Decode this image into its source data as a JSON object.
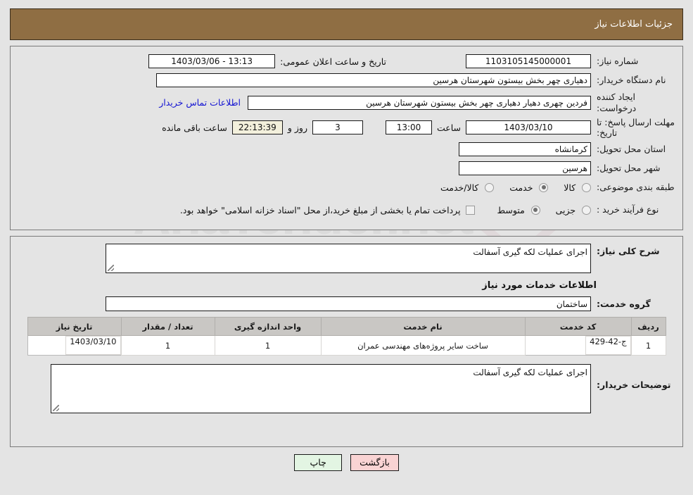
{
  "header": {
    "title": "جزئیات اطلاعات نیاز"
  },
  "info": {
    "need_number_label": "شماره نیاز:",
    "need_number_value": "1103105145000001",
    "announce_label": "تاریخ و ساعت اعلان عمومی:",
    "announce_value": "1403/03/06 - 13:13",
    "buyer_org_label": "نام دستگاه خریدار:",
    "buyer_org_value": "دهیاری چهر بخش بیستون شهرستان هرسین",
    "creator_label": "ایجاد کننده درخواست:",
    "creator_value": "فردین چهری دهیار دهیاری چهر بخش بیستون شهرستان هرسین",
    "contact_link": "اطلاعات تماس خریدار",
    "deadline_label": "مهلت ارسال پاسخ: تا تاریخ:",
    "deadline_date": "1403/03/10",
    "hour_label": "ساعت",
    "deadline_time": "13:00",
    "days_value": "3",
    "days_and_label": "روز و",
    "countdown_value": "22:13:39",
    "remaining_label": "ساعت باقی مانده",
    "province_label": "استان محل تحویل:",
    "province_value": "کرمانشاه",
    "city_label": "شهر محل تحویل:",
    "city_value": "هرسین",
    "category_label": "طبقه بندی موضوعی:",
    "category_options": [
      {
        "label": "کالا",
        "checked": false
      },
      {
        "label": "خدمت",
        "checked": true
      },
      {
        "label": "کالا/خدمت",
        "checked": false
      }
    ],
    "process_label": "نوع فرآیند خرید :",
    "process_options": [
      {
        "label": "جزیی",
        "checked": false
      },
      {
        "label": "متوسط",
        "checked": true
      }
    ],
    "treasury_checkbox_checked": false,
    "treasury_note": "پرداخت تمام یا بخشی از مبلغ خرید،از محل \"اسناد خزانه اسلامی\" خواهد بود."
  },
  "detail": {
    "summary_label": "شرح کلی نیاز:",
    "summary_value": "اجرای عملیات لکه گیری آسفالت",
    "services_heading": "اطلاعات خدمات مورد نیاز",
    "service_group_label": "گروه خدمت:",
    "service_group_value": "ساختمان",
    "notes_label": "توضیحات خریدار:",
    "notes_value": "اجرای عملیات لکه گیری آسفالت"
  },
  "table": {
    "columns": [
      "ردیف",
      "کد خدمت",
      "نام خدمت",
      "واحد اندازه گیری",
      "تعداد / مقدار",
      "تاریخ نیاز"
    ],
    "rows": [
      {
        "row_no": "1",
        "service_code": "ج-42-429",
        "service_name": "ساخت سایر پروژه‌های مهندسی عمران",
        "unit": "1",
        "quantity": "1",
        "need_date": "1403/03/10"
      }
    ]
  },
  "footer": {
    "print_label": "چاپ",
    "back_label": "بازگشت"
  },
  "watermark": {
    "text": "AnaTender.net",
    "mark": "V"
  },
  "colors": {
    "header_bg": "#8f6e43",
    "page_bg": "#e4e4e4",
    "link": "#1414d2",
    "back_btn": "#f9d3d3",
    "print_btn": "#e3f5e3",
    "countdown_bg": "#f3f0dc",
    "table_header": "#c9c7c4"
  }
}
